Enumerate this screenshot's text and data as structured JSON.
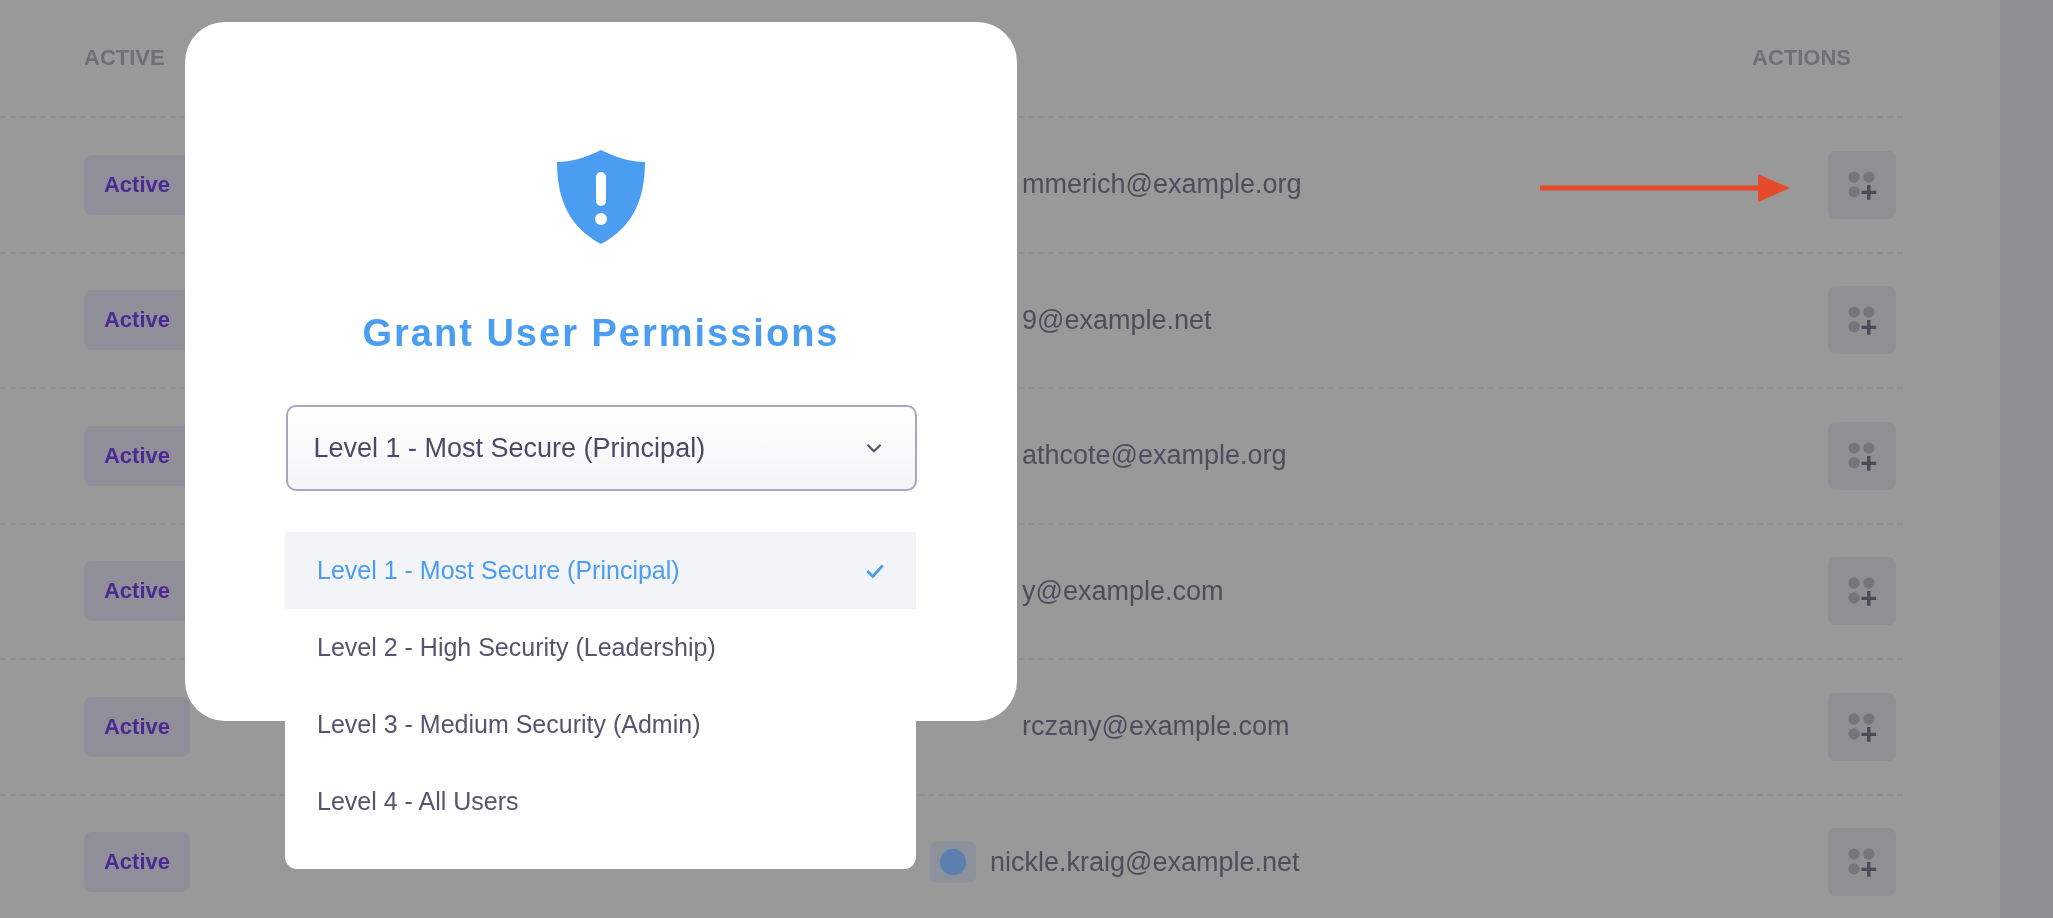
{
  "table": {
    "columns": [
      {
        "label": "ACTIVE"
      },
      {
        "label": "ACTIONS"
      }
    ],
    "rows": [
      {
        "status": "Active",
        "email": "mmerich@example.org",
        "avatar": false
      },
      {
        "status": "Active",
        "email": "9@example.net",
        "avatar": false
      },
      {
        "status": "Active",
        "email": "athcote@example.org",
        "avatar": false
      },
      {
        "status": "Active",
        "email": "y@example.com",
        "avatar": false
      },
      {
        "status": "Active",
        "email": "rczany@example.com",
        "avatar": false
      },
      {
        "status": "Active",
        "email": "nickle.kraig@example.net",
        "avatar": true
      }
    ]
  },
  "modal": {
    "title": "Grant User Permissions",
    "select": {
      "value": "Level 1 - Most Secure (Principal)"
    },
    "options": [
      {
        "label": "Level 1 - Most Secure (Principal)",
        "selected": true
      },
      {
        "label": "Level 2 - High Security (Leadership)",
        "selected": false
      },
      {
        "label": "Level 3 - Medium Security (Admin)",
        "selected": false
      },
      {
        "label": "Level 4 - All Users",
        "selected": false
      }
    ]
  }
}
